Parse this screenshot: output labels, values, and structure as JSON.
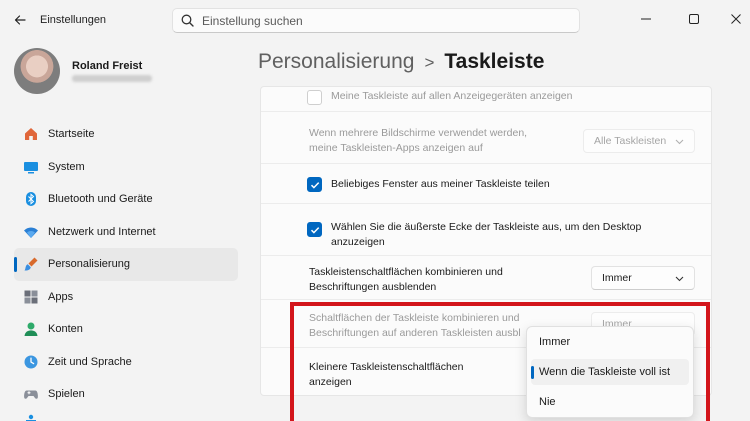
{
  "window": {
    "title": "Einstellungen",
    "back_icon": "back-arrow-icon",
    "controls": [
      "minimize-icon",
      "maximize-icon",
      "close-icon"
    ]
  },
  "search": {
    "placeholder": "Einstellung suchen",
    "icon": "search-icon"
  },
  "user": {
    "name": "Roland Freist"
  },
  "nav": {
    "items": [
      {
        "label": "Startseite",
        "icon": "home-icon"
      },
      {
        "label": "System",
        "icon": "monitor-icon"
      },
      {
        "label": "Bluetooth und Geräte",
        "icon": "bluetooth-icon"
      },
      {
        "label": "Netzwerk und Internet",
        "icon": "wifi-icon"
      },
      {
        "label": "Personalisierung",
        "icon": "brush-icon",
        "active": true
      },
      {
        "label": "Apps",
        "icon": "apps-icon"
      },
      {
        "label": "Konten",
        "icon": "account-icon"
      },
      {
        "label": "Zeit und Sprache",
        "icon": "globe-clock-icon"
      },
      {
        "label": "Spielen",
        "icon": "gamepad-icon"
      }
    ]
  },
  "breadcrumb": {
    "parent": "Personalisierung",
    "separator": ">",
    "current": "Taskleiste"
  },
  "settings": {
    "rows": [
      {
        "text": "Meine Taskleiste auf allen Anzeigegeräten anzeigen",
        "checkbox": true,
        "checked": false,
        "disabled": true
      },
      {
        "text": "Wenn mehrere Bildschirme verwendet werden, meine Taskleisten-Apps anzeigen auf",
        "dropdown": "Alle Taskleisten",
        "disabled": true
      },
      {
        "text": "Beliebiges Fenster aus meiner Taskleiste teilen",
        "checkbox": true,
        "checked": true
      },
      {
        "text": "Wählen Sie die äußerste Ecke der Taskleiste aus, um den Desktop anzuzeigen",
        "checkbox": true,
        "checked": true
      },
      {
        "text": "Taskleistenschaltflächen kombinieren und Beschriftungen ausblenden",
        "dropdown": "Immer"
      },
      {
        "text": "Schaltflächen der Taskleiste kombinieren und Beschriftungen auf anderen Taskleisten ausbl",
        "dropdown": "Immer",
        "disabled": true
      },
      {
        "text": "Kleinere Taskleistenschaltflächen anzeigen"
      }
    ]
  },
  "dropdown_menu": {
    "options": [
      "Immer",
      "Wenn die Taskleiste voll ist",
      "Nie"
    ],
    "selected_index": 1
  },
  "colors": {
    "accent": "#0067c0",
    "highlight_frame": "#d3151b"
  }
}
